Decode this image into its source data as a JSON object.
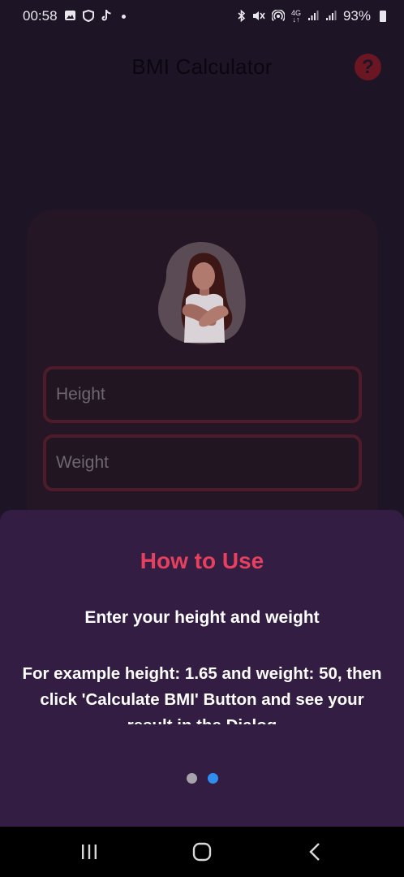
{
  "status_bar": {
    "time": "00:58",
    "battery": "93%",
    "left_icons": [
      "gallery-icon",
      "shield-icon",
      "tiktok-icon",
      "dot-icon"
    ],
    "right_icons": [
      "bluetooth-icon",
      "mute-icon",
      "hotspot-icon",
      "4g-icon",
      "signal-icon",
      "signal-icon",
      "battery-icon"
    ]
  },
  "app_bar": {
    "title": "BMI Calculator",
    "help_icon": "help-icon"
  },
  "form": {
    "height_label": "Height",
    "weight_label": "Weight"
  },
  "sheet": {
    "title": "How to Use",
    "subtitle": "Enter your height and weight",
    "body": "For example height: 1.65 and weight: 50, then click 'Calculate BMI' Button and see your result in the Dialog",
    "page_count": 2,
    "active_page": 2
  },
  "colors": {
    "background": "#1d1525",
    "sheet": "#331d42",
    "title_accent": "#e5405e",
    "active_dot": "#2f8ff0"
  },
  "nav_bar": {
    "buttons": [
      "recents-icon",
      "home-icon",
      "back-icon"
    ]
  }
}
